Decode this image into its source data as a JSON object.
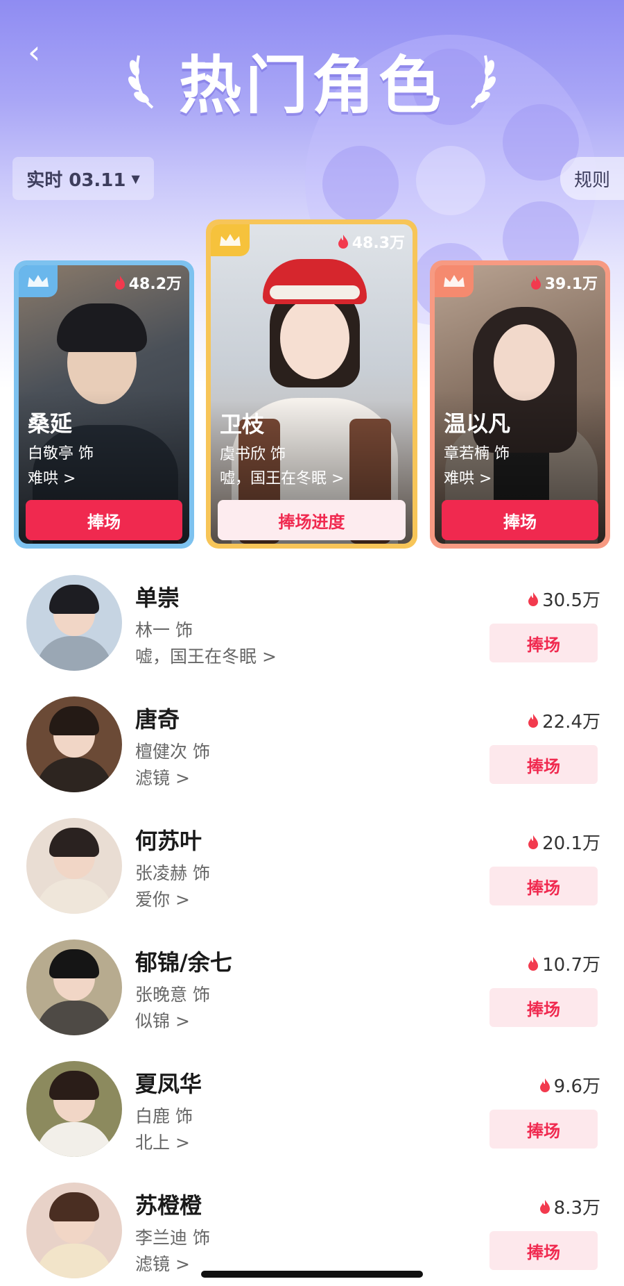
{
  "header": {
    "title": "热门角色",
    "date_label": "实时 03.11",
    "rules_label": "规则"
  },
  "top3": [
    {
      "rank_color": "#6ab7ec",
      "heat": "48.2万",
      "name": "桑延",
      "actor": "白敬亭 饰",
      "show": "难哄 >",
      "button": "捧场"
    },
    {
      "rank_color": "#f6c23c",
      "heat": "48.3万",
      "name": "卫枝",
      "actor": "虞书欣 饰",
      "show": "嘘，国王在冬眠 >",
      "button": "捧场进度"
    },
    {
      "rank_color": "#f58a6f",
      "heat": "39.1万",
      "name": "温以凡",
      "actor": "章若楠 饰",
      "show": "难哄 >",
      "button": "捧场"
    }
  ],
  "list": [
    {
      "name": "单崇",
      "actor": "林一 饰",
      "show": "嘘，国王在冬眠 >",
      "heat": "30.5万",
      "button": "捧场"
    },
    {
      "name": "唐奇",
      "actor": "檀健次 饰",
      "show": "滤镜 >",
      "heat": "22.4万",
      "button": "捧场"
    },
    {
      "name": "何苏叶",
      "actor": "张凌赫 饰",
      "show": "爱你 >",
      "heat": "20.1万",
      "button": "捧场"
    },
    {
      "name": "郁锦/余七",
      "actor": "张晚意 饰",
      "show": "似锦 >",
      "heat": "10.7万",
      "button": "捧场"
    },
    {
      "name": "夏凤华",
      "actor": "白鹿 饰",
      "show": "北上 >",
      "heat": "9.6万",
      "button": "捧场"
    },
    {
      "name": "苏橙橙",
      "actor": "李兰迪 饰",
      "show": "滤镜 >",
      "heat": "8.3万",
      "button": "捧场"
    }
  ],
  "colors": {
    "accent_red": "#f0294f",
    "flame": "#f23a4e",
    "button_light": "#fde8ec"
  }
}
